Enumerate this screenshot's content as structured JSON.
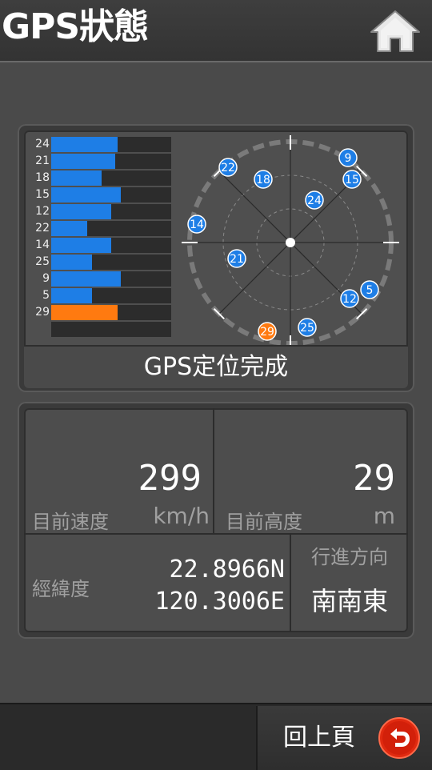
{
  "header": {
    "title": "GPS狀態",
    "home_icon": "home-icon"
  },
  "satellites_bars": [
    {
      "id": "24",
      "level": 0.55,
      "color": "#1e7ee6"
    },
    {
      "id": "21",
      "level": 0.53,
      "color": "#1e7ee6"
    },
    {
      "id": "18",
      "level": 0.42,
      "color": "#1e7ee6"
    },
    {
      "id": "15",
      "level": 0.58,
      "color": "#1e7ee6"
    },
    {
      "id": "12",
      "level": 0.5,
      "color": "#1e7ee6"
    },
    {
      "id": "22",
      "level": 0.3,
      "color": "#1e7ee6"
    },
    {
      "id": "14",
      "level": 0.5,
      "color": "#1e7ee6"
    },
    {
      "id": "25",
      "level": 0.34,
      "color": "#1e7ee6"
    },
    {
      "id": "9",
      "level": 0.58,
      "color": "#1e7ee6"
    },
    {
      "id": "5",
      "level": 0.34,
      "color": "#1e7ee6"
    },
    {
      "id": "29",
      "level": 0.55,
      "color": "#ff7a10"
    }
  ],
  "radar_sats": [
    {
      "id": "9",
      "color": "#1e7ee6"
    },
    {
      "id": "22",
      "color": "#1e7ee6"
    },
    {
      "id": "18",
      "color": "#1e7ee6"
    },
    {
      "id": "15",
      "color": "#1e7ee6"
    },
    {
      "id": "24",
      "color": "#1e7ee6"
    },
    {
      "id": "14",
      "color": "#1e7ee6"
    },
    {
      "id": "21",
      "color": "#1e7ee6"
    },
    {
      "id": "5",
      "color": "#1e7ee6"
    },
    {
      "id": "12",
      "color": "#1e7ee6"
    },
    {
      "id": "29",
      "color": "#ff7a10"
    },
    {
      "id": "25",
      "color": "#1e7ee6"
    }
  ],
  "gps_status": "GPS定位完成",
  "info": {
    "speed_value": "299",
    "speed_label": "目前速度",
    "speed_unit": "km/h",
    "altitude_value": "29",
    "altitude_label": "目前高度",
    "altitude_unit": "m",
    "latlon_label": "經緯度",
    "latitude": "22.8966N",
    "longitude": "120.3006E",
    "heading_label": "行進方向",
    "heading_value": "南南東"
  },
  "footer": {
    "back_label": "回上頁",
    "back_icon": "back-arrow-icon"
  },
  "colors": {
    "blue": "#1e7ee6",
    "orange": "#ff7a10",
    "back_red": "#e02a10"
  }
}
